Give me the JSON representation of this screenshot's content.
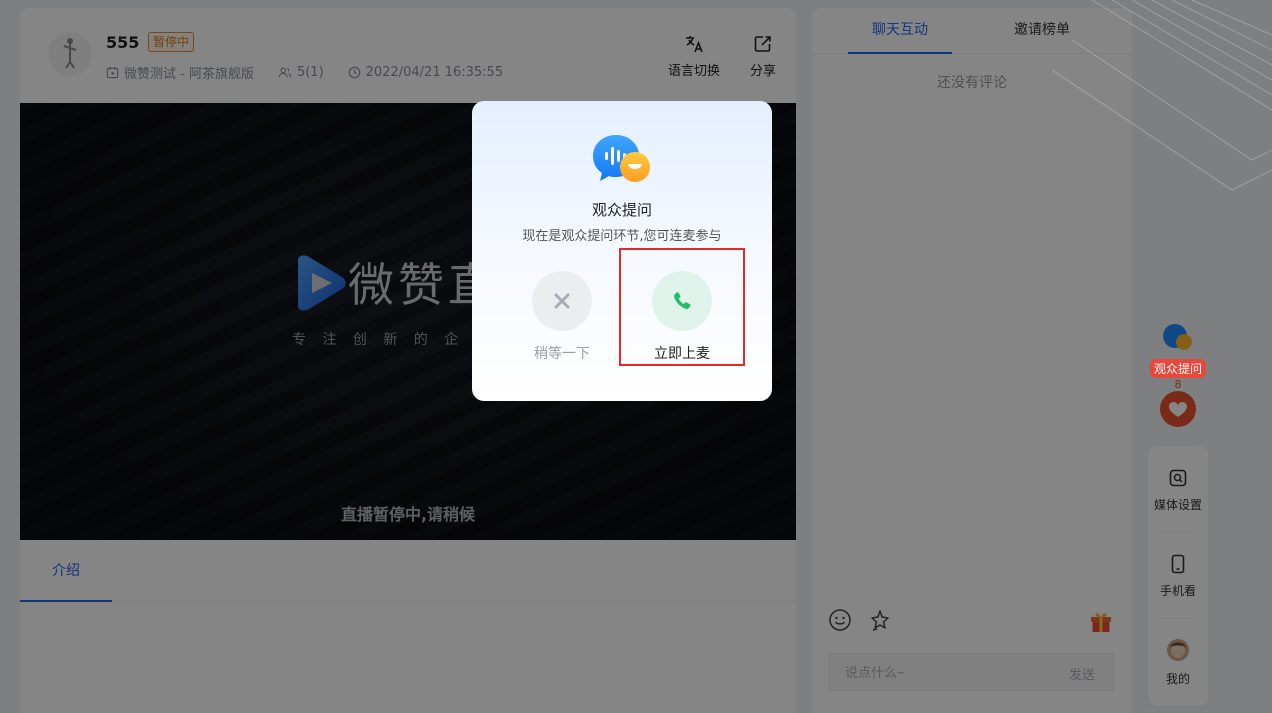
{
  "header": {
    "room_title": "555",
    "status": "暂停中",
    "channel": "微赞测试 - 阿茶旗舰版",
    "viewers": "5(1)",
    "datetime": "2022/04/21 16:35:55",
    "actions": [
      {
        "label": "语言切换",
        "icon": "translate-icon"
      },
      {
        "label": "分享",
        "icon": "share-icon"
      }
    ]
  },
  "video": {
    "brand_text": "微赞直",
    "slogan": "专 注 创 新 的 企 业 直 播",
    "paused_message": "直播暂停中,请稍候"
  },
  "intro_tabs": [
    {
      "label": "介绍",
      "active": true
    }
  ],
  "chat": {
    "tabs": [
      {
        "label": "聊天互动",
        "active": true
      },
      {
        "label": "邀请榜单",
        "active": false
      }
    ],
    "empty_text": "还没有评论",
    "input_placeholder": "说点什么~",
    "send_label": "发送"
  },
  "sidebar": {
    "qa_label": "观众提问",
    "like_count": "8",
    "items": [
      {
        "label": "媒体设置",
        "icon": "media-settings-icon"
      },
      {
        "label": "手机看",
        "icon": "phone-icon"
      },
      {
        "label": "我的",
        "icon": "avatar"
      }
    ]
  },
  "modal": {
    "title": "观众提问",
    "description": "现在是观众提问环节,您可连麦参与",
    "wait_label": "稍等一下",
    "join_label": "立即上麦"
  },
  "colors": {
    "accent": "#2866ea",
    "status_orange": "#e07b14",
    "join_green": "#1fbf6a",
    "highlight_red": "#e02b2b"
  }
}
